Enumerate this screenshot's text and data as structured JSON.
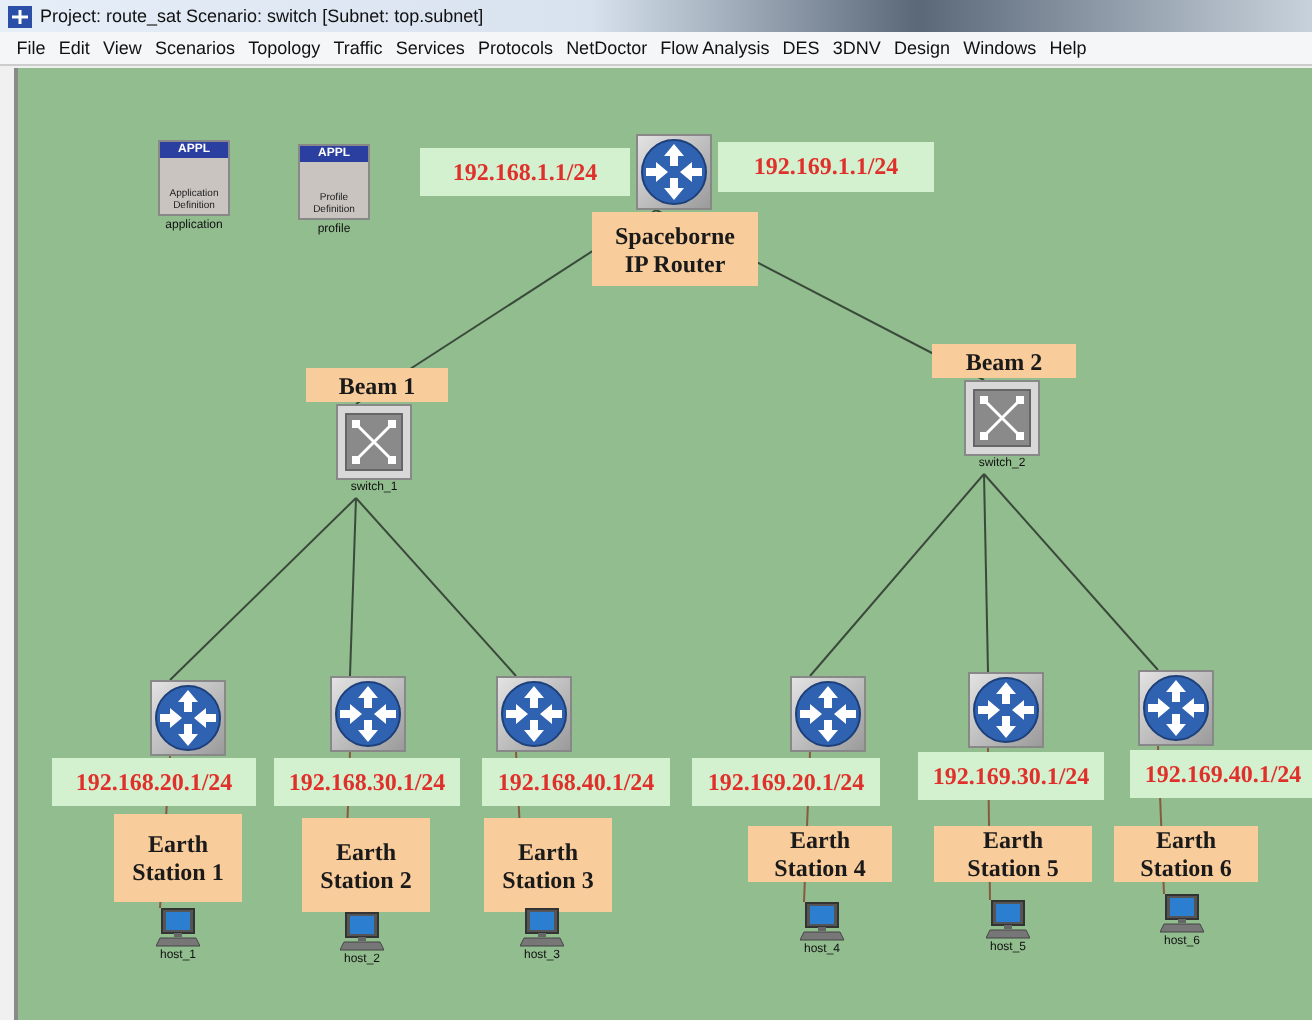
{
  "window": {
    "title": "Project: route_sat Scenario: switch  [Subnet: top.subnet]"
  },
  "menu": [
    "File",
    "Edit",
    "View",
    "Scenarios",
    "Topology",
    "Traffic",
    "Services",
    "Protocols",
    "NetDoctor",
    "Flow Analysis",
    "DES",
    "3DNV",
    "Design",
    "Windows",
    "Help"
  ],
  "utility_nodes": [
    {
      "badge": "APPL",
      "caption": "Application Definition",
      "label": "application"
    },
    {
      "badge": "APPL",
      "caption": "Profile Definition",
      "label": "profile"
    }
  ],
  "core_router": {
    "interfaces": [
      "192.168.1.1/24",
      "192.169.1.1/24"
    ],
    "name": "Spaceborne IP Router"
  },
  "switches": [
    {
      "label": "Beam 1",
      "name": "switch_1",
      "stations": [
        {
          "ip": "192.168.20.1/24",
          "label": "Earth Station 1",
          "host": "host_1"
        },
        {
          "ip": "192.168.30.1/24",
          "label": "Earth Station 2",
          "host": "host_2"
        },
        {
          "ip": "192.168.40.1/24",
          "label": "Earth Station 3",
          "host": "host_3"
        }
      ]
    },
    {
      "label": "Beam 2",
      "name": "switch_2",
      "stations": [
        {
          "ip": "192.169.20.1/24",
          "label": "Earth Station 4",
          "host": "host_4"
        },
        {
          "ip": "192.169.30.1/24",
          "label": "Earth Station 5",
          "host": "host_5"
        },
        {
          "ip": "192.169.40.1/24",
          "label": "Earth Station 6",
          "host": "host_6"
        }
      ]
    }
  ]
}
